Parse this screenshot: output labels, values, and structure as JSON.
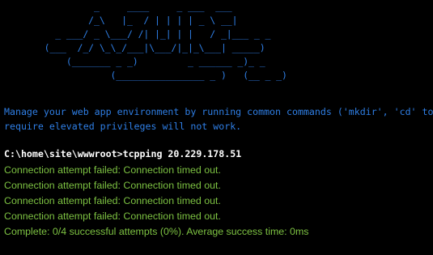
{
  "terminal": {
    "banner_ascii": "                 _     ____     _ ___  ___\n                /_\\   |_  / | | | | _ \\ __|\n          _ ___/ _ \\___/ /| |_| | |   / _|___ _ _\n        (___  /_/ \\_\\_/___|\\___/|_|_\\___| _____)\n            (_______ _ _)         _ ______ _)_ _\n                    (________________ _ )   (__ _ _)",
    "info_lines": [
      "Manage your web app environment by running common commands ('mkdir', 'cd' to char",
      "require elevated privileges will not work."
    ],
    "prompt": "C:\\home\\site\\wwwroot>",
    "command": "tcpping 20.229.178.51",
    "output_lines": [
      "Connection attempt failed: Connection timed out.",
      "Connection attempt failed: Connection timed out.",
      "Connection attempt failed: Connection timed out.",
      "Connection attempt failed: Connection timed out.",
      "Complete: 0/4 successful attempts (0%). Average success time: 0ms"
    ]
  },
  "colors": {
    "background": "#000000",
    "banner": "#2f7fe6",
    "info": "#2f7fe6",
    "prompt": "#ffffff",
    "output": "#7dc242"
  }
}
